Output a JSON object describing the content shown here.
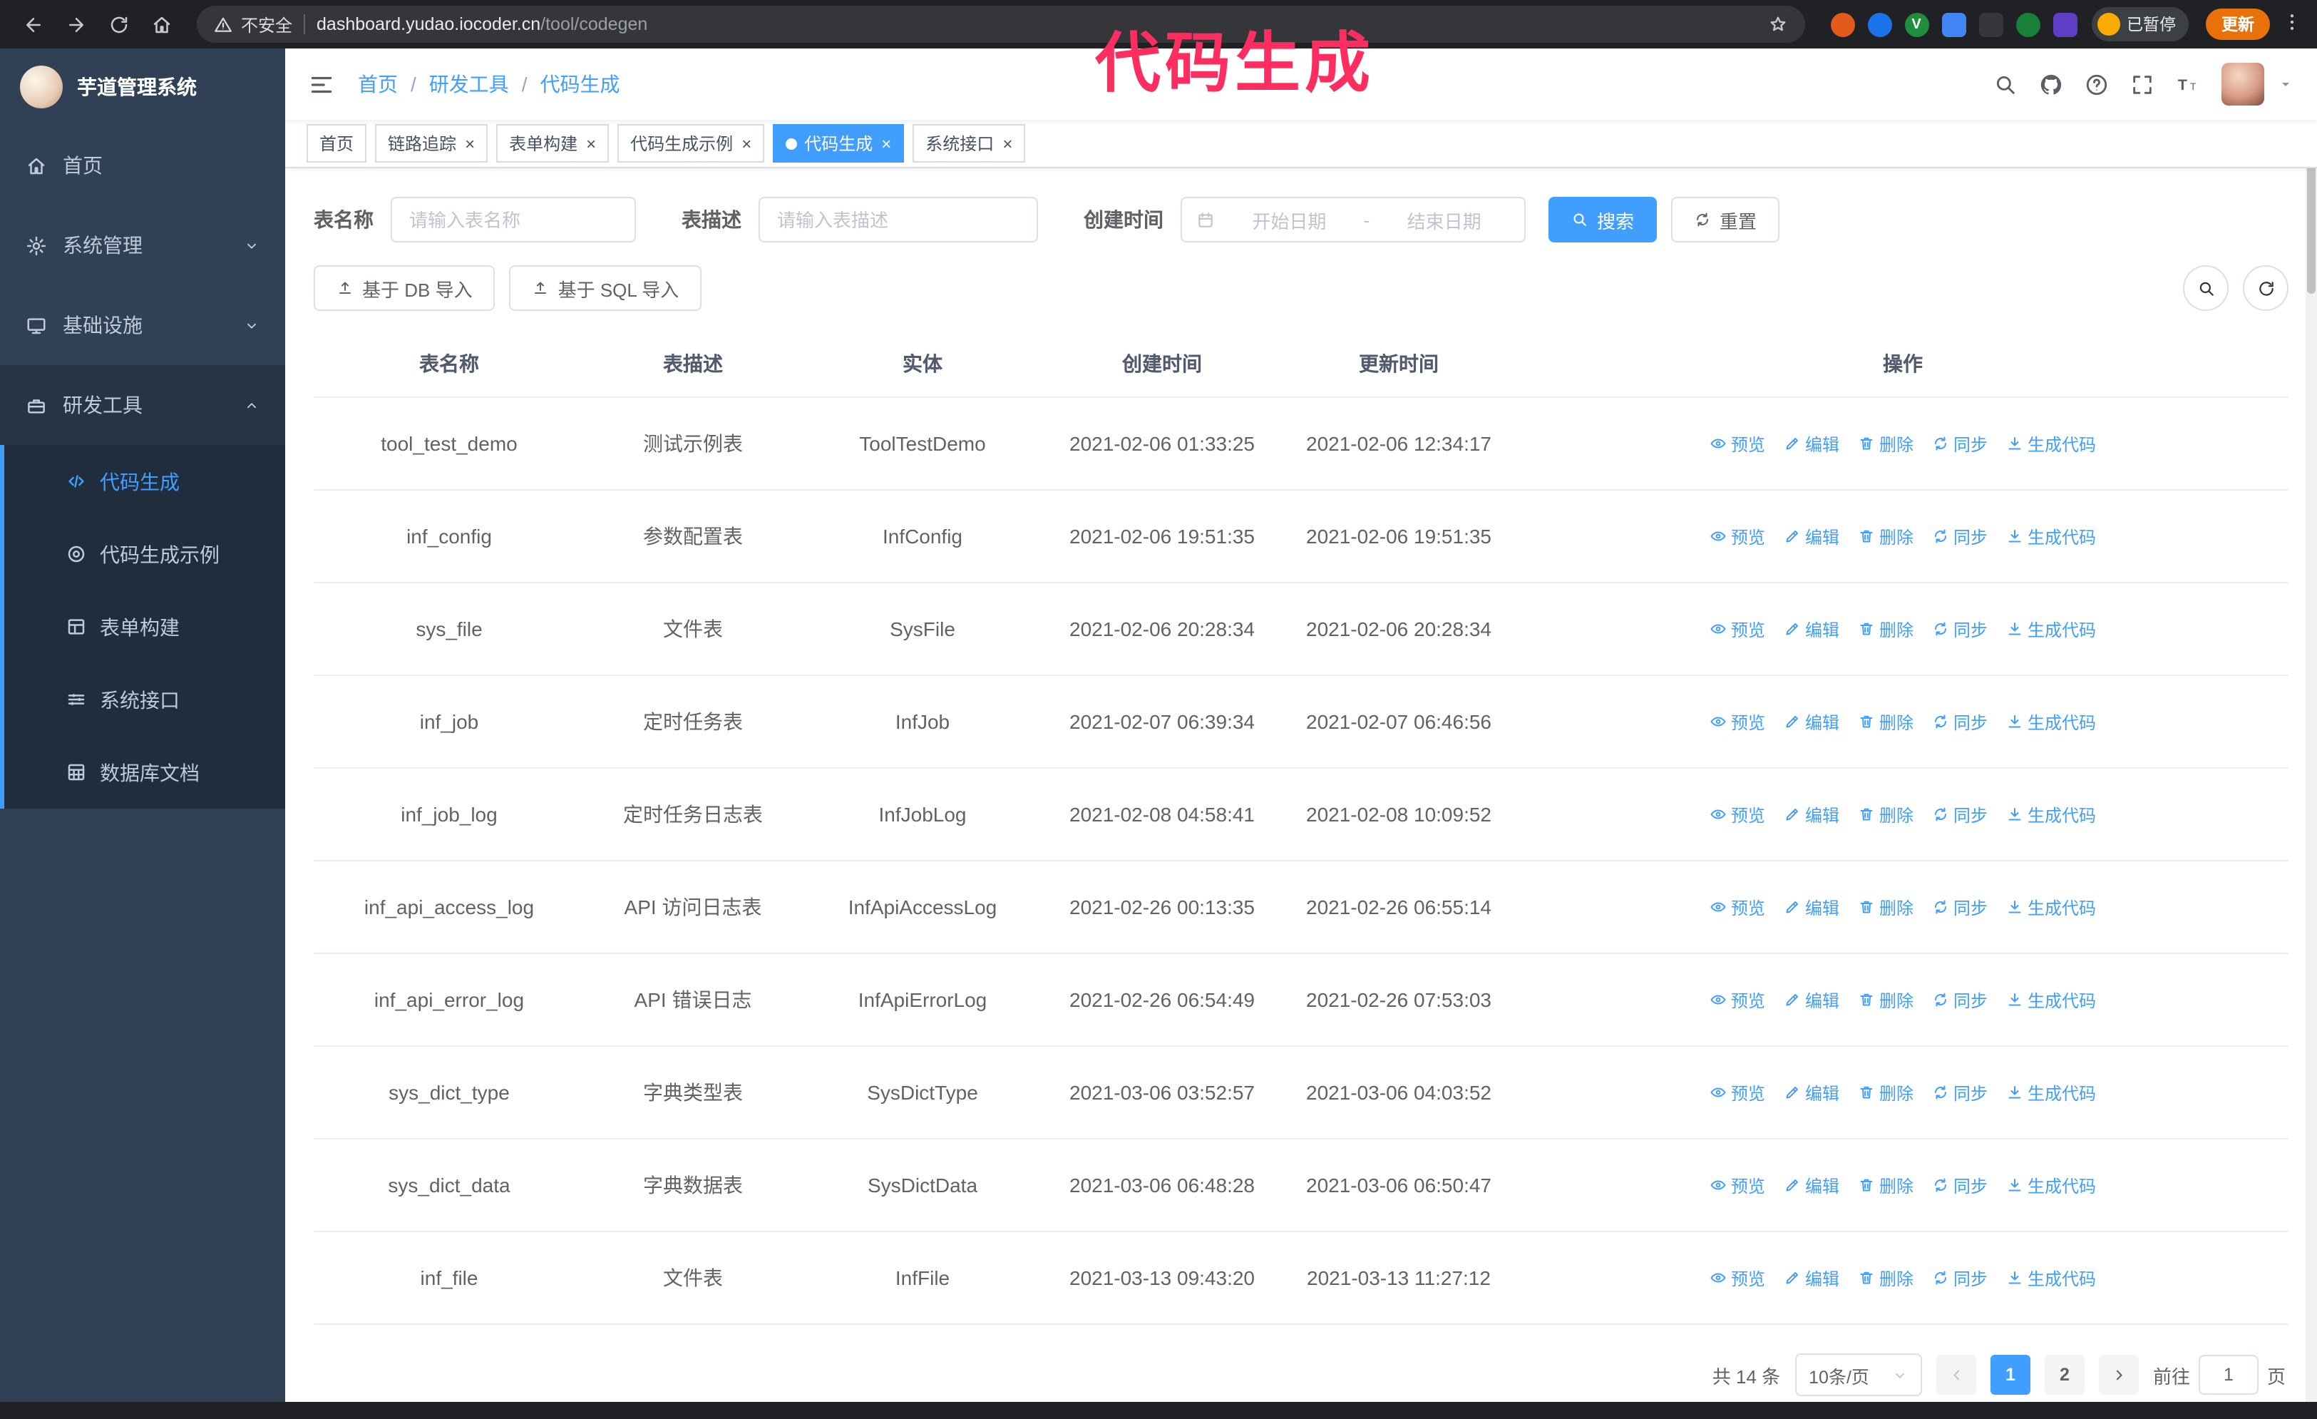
{
  "colors": {
    "accent": "#409eff",
    "sidebar_bg": "#304156",
    "submenu_bg": "#1f2d3d",
    "annotation": "#fb2e5f",
    "update_pill": "#e8710a"
  },
  "annotation": {
    "text": "代码生成"
  },
  "browser": {
    "security_label": "不安全",
    "url_host": "dashboard.yudao.iocoder.cn",
    "url_path": "/tool/codegen",
    "profile_chip": "已暂停",
    "update_button": "更新",
    "extensions": [
      {
        "name": "extension-icon-1",
        "color": "#e25a1c",
        "shape": "circle",
        "glyph": ""
      },
      {
        "name": "extension-icon-2",
        "color": "#1a73e8",
        "shape": "circle",
        "glyph": ""
      },
      {
        "name": "extension-icon-3",
        "color": "#1e8e3e",
        "shape": "circle",
        "glyph": "V"
      },
      {
        "name": "extension-icon-4",
        "color": "#4285f4",
        "shape": "square",
        "glyph": ""
      },
      {
        "name": "extension-icon-5",
        "color": "#35363a",
        "shape": "square",
        "glyph": ""
      },
      {
        "name": "extension-icon-6",
        "color": "#188038",
        "shape": "circle",
        "glyph": ""
      },
      {
        "name": "extension-icon-7",
        "color": "#5f3dc4",
        "shape": "square",
        "glyph": ""
      }
    ]
  },
  "sidebar": {
    "logo_title": "芋道管理系统",
    "menu": [
      {
        "name": "home",
        "label": "首页",
        "icon": "home-icon"
      },
      {
        "name": "system-mgmt",
        "label": "系统管理",
        "icon": "gear-icon",
        "collapsible": true
      },
      {
        "name": "infrastructure",
        "label": "基础设施",
        "icon": "infra-icon",
        "collapsible": true
      },
      {
        "name": "dev-tools",
        "label": "研发工具",
        "icon": "tools-icon",
        "collapsible": true,
        "expanded": true,
        "children": [
          {
            "name": "codegen",
            "label": "代码生成",
            "icon": "code-icon",
            "active": true
          },
          {
            "name": "codegen-example",
            "label": "代码生成示例",
            "icon": "example-icon"
          },
          {
            "name": "form-builder",
            "label": "表单构建",
            "icon": "form-icon"
          },
          {
            "name": "system-api",
            "label": "系统接口",
            "icon": "api-icon"
          },
          {
            "name": "db-doc",
            "label": "数据库文档",
            "icon": "dbdoc-icon"
          }
        ]
      }
    ]
  },
  "header": {
    "breadcrumb": [
      "首页",
      "研发工具",
      "代码生成"
    ],
    "separator": "/"
  },
  "tabs": [
    {
      "name": "home",
      "label": "首页",
      "closable": false,
      "active": false
    },
    {
      "name": "tracing",
      "label": "链路追踪",
      "closable": true,
      "active": false
    },
    {
      "name": "form-builder",
      "label": "表单构建",
      "closable": true,
      "active": false
    },
    {
      "name": "codegen-example",
      "label": "代码生成示例",
      "closable": true,
      "active": false
    },
    {
      "name": "codegen",
      "label": "代码生成",
      "closable": true,
      "active": true
    },
    {
      "name": "system-api",
      "label": "系统接口",
      "closable": true,
      "active": false
    }
  ],
  "filters": {
    "table_name_label": "表名称",
    "table_name_placeholder": "请输入表名称",
    "table_desc_label": "表描述",
    "table_desc_placeholder": "请输入表描述",
    "create_time_label": "创建时间",
    "date_start_placeholder": "开始日期",
    "date_separator": "-",
    "date_end_placeholder": "结束日期",
    "search_button": "搜索",
    "reset_button": "重置"
  },
  "toolbar": {
    "import_db_button": "基于 DB 导入",
    "import_sql_button": "基于 SQL 导入"
  },
  "table": {
    "columns": [
      "表名称",
      "表描述",
      "实体",
      "创建时间",
      "更新时间",
      "操作"
    ],
    "ops": [
      {
        "name": "preview",
        "label": "预览",
        "icon": "eye-icon"
      },
      {
        "name": "edit",
        "label": "编辑",
        "icon": "edit-icon"
      },
      {
        "name": "delete",
        "label": "删除",
        "icon": "delete-icon"
      },
      {
        "name": "sync",
        "label": "同步",
        "icon": "sync-icon"
      },
      {
        "name": "generate-code",
        "label": "生成代码",
        "icon": "download-icon"
      }
    ],
    "rows": [
      [
        "tool_test_demo",
        "测试示例表",
        "ToolTestDemo",
        "2021-02-06 01:33:25",
        "2021-02-06 12:34:17"
      ],
      [
        "inf_config",
        "参数配置表",
        "InfConfig",
        "2021-02-06 19:51:35",
        "2021-02-06 19:51:35"
      ],
      [
        "sys_file",
        "文件表",
        "SysFile",
        "2021-02-06 20:28:34",
        "2021-02-06 20:28:34"
      ],
      [
        "inf_job",
        "定时任务表",
        "InfJob",
        "2021-02-07 06:39:34",
        "2021-02-07 06:46:56"
      ],
      [
        "inf_job_log",
        "定时任务日志表",
        "InfJobLog",
        "2021-02-08 04:58:41",
        "2021-02-08 10:09:52"
      ],
      [
        "inf_api_access_log",
        "API 访问日志表",
        "InfApiAccessLog",
        "2021-02-26 00:13:35",
        "2021-02-26 06:55:14"
      ],
      [
        "inf_api_error_log",
        "API 错误日志",
        "InfApiErrorLog",
        "2021-02-26 06:54:49",
        "2021-02-26 07:53:03"
      ],
      [
        "sys_dict_type",
        "字典类型表",
        "SysDictType",
        "2021-03-06 03:52:57",
        "2021-03-06 04:03:52"
      ],
      [
        "sys_dict_data",
        "字典数据表",
        "SysDictData",
        "2021-03-06 06:48:28",
        "2021-03-06 06:50:47"
      ],
      [
        "inf_file",
        "文件表",
        "InfFile",
        "2021-03-13 09:43:20",
        "2021-03-13 11:27:12"
      ]
    ]
  },
  "pagination": {
    "total_text": "共 14 条",
    "page_size": "10条/页",
    "pages": [
      "1",
      "2"
    ],
    "active_page": "1",
    "goto_label": "前往",
    "goto_value": "1",
    "goto_suffix": "页"
  }
}
